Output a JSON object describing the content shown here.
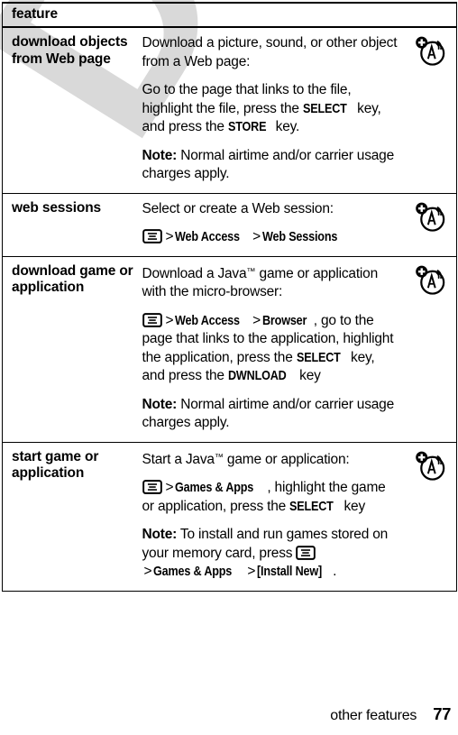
{
  "watermark": {
    "text": "DRAFT",
    "color": "#d9d9d9"
  },
  "table": {
    "header": {
      "label": "feature"
    },
    "rows": [
      {
        "term": "download objects from Web page",
        "icon": "airtime-charges-icon",
        "paragraphs": [
          {
            "id": "p1",
            "text": "Download a picture, sound, or other object from a Web page:"
          },
          {
            "id": "p2",
            "pre": "Go to the page that links to the file, highlight the file, press the ",
            "key1": "SELECT",
            "mid": " key, and press the ",
            "key2": "STORE",
            "post": " key."
          },
          {
            "id": "p3",
            "note": "Note:",
            "text": " Normal airtime and/or carrier usage charges apply."
          }
        ]
      },
      {
        "term": "web sessions",
        "icon": "airtime-charges-icon",
        "paragraphs": [
          {
            "id": "p1",
            "text": "Select or create a Web session:"
          },
          {
            "id": "p2",
            "menu_icon": "menu-key-icon",
            "sep1": ">",
            "path1": "Web Access",
            "sep2": ">",
            "path2": "Web Sessions"
          }
        ]
      },
      {
        "term": "download game or application",
        "icon": "airtime-charges-icon",
        "paragraphs": [
          {
            "id": "p1",
            "pre": "Download a Java",
            "tm": "™",
            "post": " game or application with the micro-browser:"
          },
          {
            "id": "p2",
            "menu_icon": "menu-key-icon",
            "sep1": ">",
            "path1": "Web Access",
            "sep2": ">",
            "path2": "Browser",
            "mid": ", go to the page that links to the application, highlight the application, press the ",
            "key1": "SELECT",
            "mid2": " key, and press the ",
            "key2": "DWNLOAD",
            "post": " key"
          },
          {
            "id": "p3",
            "note": "Note:",
            "text": " Normal airtime and/or carrier usage charges apply."
          }
        ]
      },
      {
        "term": "start game or application",
        "icon": "airtime-charges-icon",
        "paragraphs": [
          {
            "id": "p1",
            "pre": "Start a Java",
            "tm": "™",
            "post": " game or application:"
          },
          {
            "id": "p2",
            "menu_icon": "menu-key-icon",
            "sep1": ">",
            "path1": "Games & Apps",
            "mid": ", highlight the game or application, press the ",
            "key1": "SELECT",
            "post": " key"
          },
          {
            "id": "p3",
            "note": "Note:",
            "pre": " To install and run games stored on your memory card, press ",
            "menu_icon": "menu-key-icon",
            "sep1": ">",
            "path1": "Games & Apps",
            "sep2": ">",
            "path2": "[Install New]",
            "post": "."
          }
        ]
      }
    ]
  },
  "footer": {
    "title": "other features",
    "page": "77"
  }
}
